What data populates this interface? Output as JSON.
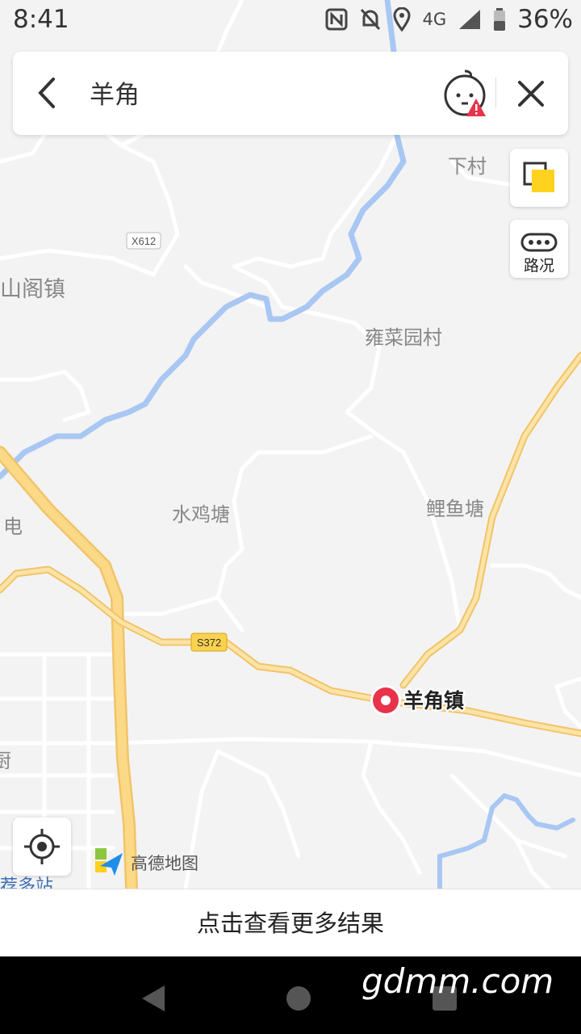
{
  "status_bar": {
    "time": "8:41",
    "network": "4G",
    "battery": "36%",
    "icons": [
      "nfc-icon",
      "alarm-off-icon",
      "location-icon",
      "signal-icon",
      "battery-icon"
    ]
  },
  "search": {
    "back_icon": "chevron-left-icon",
    "query": "羊角",
    "feedback_icon": "feedback-mascot-icon",
    "close_icon": "close-icon"
  },
  "controls": {
    "layers_icon": "layers-icon",
    "traffic_label": "路况",
    "locate_icon": "locate-icon"
  },
  "map": {
    "place_labels": {
      "xiacun": "下村",
      "shangezhen": "山阁镇",
      "yongcaiyuan": "雍菜园村",
      "shuijitang": "水鸡塘",
      "liyutang": "鲤鱼塘",
      "dian": "电",
      "ya": "厨"
    },
    "road_shields": {
      "x612": "X612",
      "s372": "S372"
    },
    "selected_place": "羊角镇",
    "colors": {
      "land": "#f3f3f3",
      "river": "#a9c7f3",
      "main_road": "#fbd986",
      "main_road_casing": "#f1c46a",
      "minor_road": "#ffffff",
      "pin": "#e8334a"
    }
  },
  "logo": {
    "text": "高德地图"
  },
  "more_results": "点击查看更多结果",
  "watermark": "gdmm.com",
  "nav_bar": {
    "back_icon": "nav-back-icon",
    "home_icon": "nav-home-icon",
    "recents_icon": "nav-recents-icon"
  }
}
